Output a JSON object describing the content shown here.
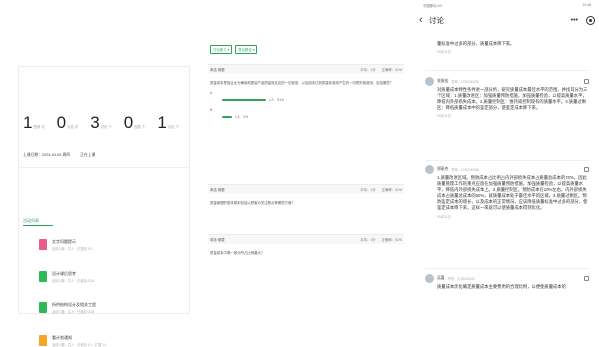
{
  "panel1": {
    "stats": [
      {
        "num": "1",
        "cap": "签到 次"
      },
      {
        "num": "0",
        "cap": "点名 次"
      },
      {
        "num": "3",
        "cap": "讨论 个"
      },
      {
        "num": "0",
        "cap": "回答 个"
      },
      {
        "num": "1",
        "cap": "讨论 个"
      }
    ],
    "last_class": "上课日期：2024-04-09 周四",
    "status": "正在上课",
    "tab": "活动列表",
    "activities": [
      {
        "title": "文字问题提示",
        "sub": "活动人数：共人 · 已签到 3人",
        "color": "#e95a8e"
      },
      {
        "title": "设计课后思考",
        "sub": "活动人数：共人 · 已参加 0/18",
        "color": "#2fb85a"
      },
      {
        "title": "所供结构设计及相关工程",
        "sub": "活动人数：共人 · 已参加 0/18",
        "color": "#2fb85a"
      },
      {
        "title": "看计划通知",
        "sub": "活动人数：共人 · 已参加 1/1 · 扩展 3人",
        "color": "#f5a623"
      }
    ]
  },
  "panel2": {
    "buttons": [
      "讨论练习 ▾",
      "导出报告 ▾"
    ],
    "cards": [
      {
        "head": "单选·概要",
        "score": "平均：1分",
        "rate": "正确率：51%",
        "question": "质量成本是指企业为确保和提高产品质量而支出的一切费用，以及因未达到质量标准而产生的一切损失和费用，包括哪些？",
        "options": [
          {
            "label": "A",
            "pct": "51%",
            "count": "1人",
            "w": 44
          },
          {
            "label": "B",
            "pct": "0%",
            "count": "1人",
            "w": 10
          }
        ]
      },
      {
        "head": "单选·概要",
        "score": "平均：1分",
        "rate": "正确率：51%",
        "question": "质量管理的基本原则包括以顾客为关注焦点等哪些方面？"
      },
      {
        "head": "单选·概要",
        "score": "平均：1分",
        "rate": "正确率：51%",
        "question": "质量成本中哪一部分所占比例最大？"
      }
    ]
  },
  "panel3": {
    "status_left": "中国移动 4G",
    "status_right": "10:48",
    "title": "讨论",
    "top_text": "量标准中过多的部分，质量成本降下来。",
    "top_date": "03月11日",
    "comments": [
      {
        "name": "张振宏",
        "num": "学号：1730230108",
        "text": "对质量成本特性条件进一部分析，研究质量成本最佳水平的范围，并找其分为三个区域：1.质量改进区：加强质量预防措施，加强质量检验，以提高质量水平，降低内外部损失成本。2.质量控制区：维持或控制现有的质量水平。3.质量过剩区：降低质量成本中的鉴定部分，使鉴定成本降下来。",
        "date": "03月11日"
      },
      {
        "name": "郑丽杰",
        "num": "学号：1730230156",
        "text": "1.质量改进区域。预防成本占比例占内外部损失成本占质量总成本的70%。因此质量管理工作的重点应放在加强质量预防措施，加强质量检验，以提高质量水平，降低内外部损失成本上。2.质量控制区。预防成本在10%左右，内外部损失成本占质量总成本的50%，就质量成本处于最佳水平的区域。3.质量过剩区。预防鉴定成本的增长，以及成本的正常情况，应该降低质量标准中过多的部分，使鉴定成本降下来，这样一来就可以使质量成本得到优化。",
        "date": "03月11日"
      },
      {
        "name": "吴嘉",
        "num": "学号：1730230120",
        "text": "质量成本优化确定质量成本主要费用的合理比例，以便使质量成本的",
        "date": ""
      }
    ]
  }
}
